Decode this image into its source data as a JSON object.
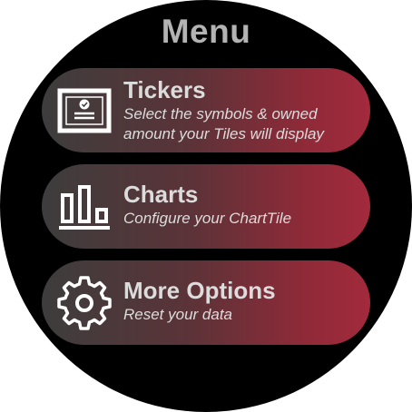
{
  "menu": {
    "title": "Menu",
    "items": [
      {
        "label": "Tickers",
        "description_line1": "Select the symbols & owned",
        "description_line2": "amount your Tiles will display",
        "icon": "certificate-icon"
      },
      {
        "label": "Charts",
        "description_line1": "Configure your ChartTile",
        "icon": "bar-chart-icon"
      },
      {
        "label": "More Options",
        "description_line1": "Reset your data",
        "icon": "gear-icon"
      }
    ]
  },
  "colors": {
    "background": "#000000",
    "title": "#b3b3b3",
    "item_gradient_start": "#3d3d3d",
    "item_gradient_end": "#a22a3c",
    "text": "#dcdcdc"
  }
}
